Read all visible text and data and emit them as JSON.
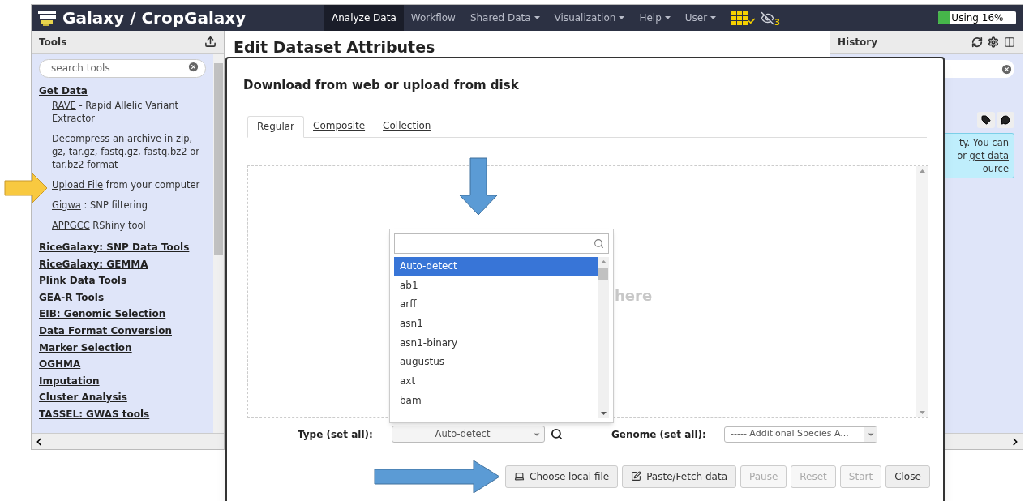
{
  "navbar": {
    "brand": "Galaxy / CropGalaxy",
    "menu": [
      {
        "label": "Analyze Data",
        "selected": true,
        "dropdown": false
      },
      {
        "label": "Workflow",
        "selected": false,
        "dropdown": false
      },
      {
        "label": "Shared Data",
        "selected": false,
        "dropdown": true
      },
      {
        "label": "Visualization",
        "selected": false,
        "dropdown": true
      },
      {
        "label": "Help",
        "selected": false,
        "dropdown": true
      },
      {
        "label": "User",
        "selected": false,
        "dropdown": true
      }
    ],
    "hidden_count": "3",
    "quota": {
      "label": "Using 16%",
      "level": 0.16
    }
  },
  "tools_panel": {
    "title": "Tools",
    "search": {
      "placeholder": "search tools"
    },
    "sections": [
      {
        "label": "Get Data",
        "tools": [
          {
            "link": "RAVE",
            "text": " - Rapid Allelic Variant Extractor"
          },
          {
            "link": "Decompress an archive",
            "text": " in zip, gz, tar.gz, fastq.gz, fastq.bz2 or tar.bz2 format"
          },
          {
            "link": "Upload File",
            "text": " from your computer"
          },
          {
            "link": "Gigwa",
            "text": " : SNP filtering"
          },
          {
            "link": "APPGCC",
            "text": " RShiny tool"
          }
        ]
      },
      {
        "label": "RiceGalaxy: SNP Data Tools"
      },
      {
        "label": "RiceGalaxy: GEMMA"
      },
      {
        "label": "Plink Data Tools"
      },
      {
        "label": "GEA-R Tools"
      },
      {
        "label": "EIB: Genomic Selection"
      },
      {
        "label": "Data Format Conversion"
      },
      {
        "label": "Marker Selection"
      },
      {
        "label": "OGHMA"
      },
      {
        "label": "Imputation"
      },
      {
        "label": "Cluster Analysis"
      },
      {
        "label": "TASSEL: GWAS tools"
      }
    ]
  },
  "center": {
    "heading": "Edit Dataset Attributes"
  },
  "history_panel": {
    "title": "History",
    "notice": {
      "line_1": "ty. You can",
      "line_2_text": "or ",
      "line_2_link": "get data",
      "line_3_link": "ource"
    }
  },
  "upload_dialog": {
    "title": "Download from web or upload from disk",
    "tabs": [
      {
        "label": "Regular",
        "selected": true
      },
      {
        "label": "Composite",
        "selected": false
      },
      {
        "label": "Collection",
        "selected": false
      }
    ],
    "drop_hint": "here",
    "type_options": [
      {
        "label": "Auto-detect",
        "selected": true
      },
      {
        "label": "ab1",
        "selected": false
      },
      {
        "label": "arff",
        "selected": false
      },
      {
        "label": "asn1",
        "selected": false
      },
      {
        "label": "asn1-binary",
        "selected": false
      },
      {
        "label": "augustus",
        "selected": false
      },
      {
        "label": "axt",
        "selected": false
      },
      {
        "label": "bam",
        "selected": false
      }
    ],
    "type_label": "Type (set all):",
    "type_value": "Auto-detect",
    "genome_label": "Genome (set all):",
    "genome_value": "----- Additional Species A...",
    "buttons": [
      {
        "label": "Choose local file",
        "kind": "local",
        "disabled": false
      },
      {
        "label": "Paste/Fetch data",
        "kind": "paste",
        "disabled": false
      },
      {
        "label": "Pause",
        "kind": "plain",
        "disabled": true
      },
      {
        "label": "Reset",
        "kind": "plain",
        "disabled": true
      },
      {
        "label": "Start",
        "kind": "plain",
        "disabled": true
      },
      {
        "label": "Close",
        "kind": "plain",
        "disabled": false
      }
    ]
  }
}
